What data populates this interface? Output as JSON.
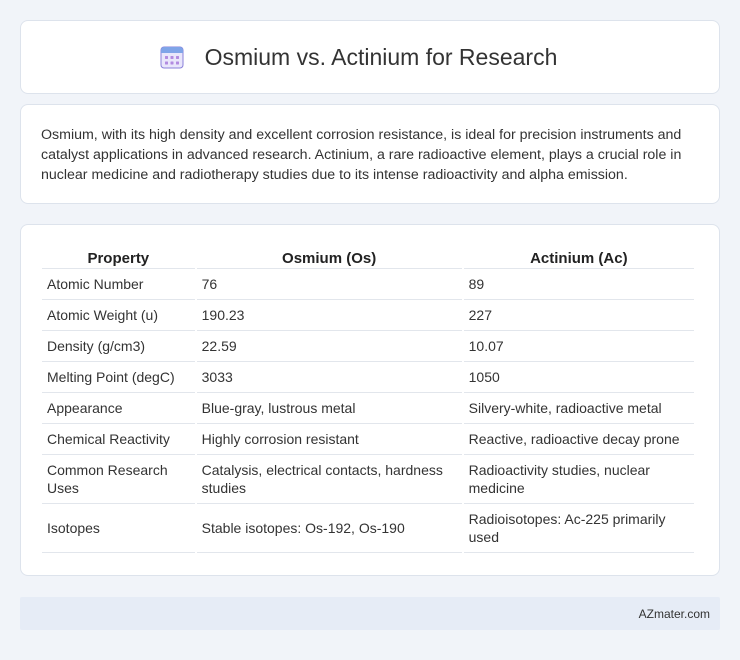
{
  "header": {
    "title": "Osmium vs. Actinium for Research",
    "icon": "calendar-icon"
  },
  "description": "Osmium, with its high density and excellent corrosion resistance, is ideal for precision instruments and catalyst applications in advanced research. Actinium, a rare radioactive element, plays a crucial role in nuclear medicine and radiotherapy studies due to its intense radioactivity and alpha emission.",
  "table": {
    "headers": [
      "Property",
      "Osmium (Os)",
      "Actinium (Ac)"
    ],
    "rows": [
      [
        "Atomic Number",
        "76",
        "89"
      ],
      [
        "Atomic Weight (u)",
        "190.23",
        "227"
      ],
      [
        "Density (g/cm3)",
        "22.59",
        "10.07"
      ],
      [
        "Melting Point (degC)",
        "3033",
        "1050"
      ],
      [
        "Appearance",
        "Blue-gray, lustrous metal",
        "Silvery-white, radioactive metal"
      ],
      [
        "Chemical Reactivity",
        "Highly corrosion resistant",
        "Reactive, radioactive decay prone"
      ],
      [
        "Common Research Uses",
        "Catalysis, electrical contacts, hardness studies",
        "Radioactivity studies, nuclear medicine"
      ],
      [
        "Isotopes",
        "Stable isotopes: Os-192, Os-190",
        "Radioisotopes: Ac-225 primarily used"
      ]
    ]
  },
  "footer": {
    "brand": "AZmater.com"
  },
  "colors": {
    "background": "#f1f4f9",
    "card": "#ffffff",
    "footer_bg": "#e6ecf6",
    "icon_accent": "#7b6fd6"
  }
}
